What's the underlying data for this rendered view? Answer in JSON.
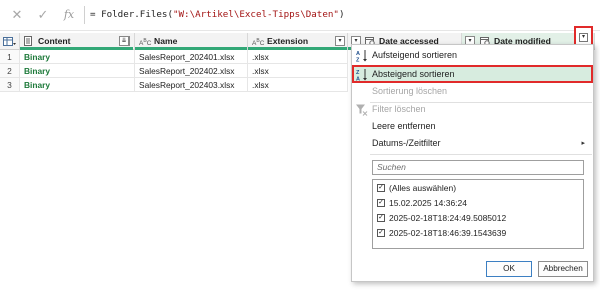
{
  "formula_bar": {
    "cancel_icon": "close-icon",
    "confirm_icon": "check-icon",
    "fx_label": "fx",
    "formula_prefix": "= Folder.Files(",
    "formula_string": "\"W:\\Artikel\\Excel-Tipps\\Daten\"",
    "formula_suffix": ")"
  },
  "columns": [
    {
      "type_icon": "table-icon",
      "label": ""
    },
    {
      "type_icon": "binary-type-icon",
      "label": "Content"
    },
    {
      "type_icon": "text-type-icon",
      "label": "Name"
    },
    {
      "type_icon": "text-type-icon",
      "label": "Extension"
    },
    {
      "type_icon": "datetime-type-icon",
      "label": "Date accessed"
    },
    {
      "type_icon": "datetime-type-icon",
      "label": "Date modified"
    }
  ],
  "rows": [
    {
      "num": "1",
      "content": "Binary",
      "name": "SalesReport_202401.xlsx",
      "extension": ".xlsx"
    },
    {
      "num": "2",
      "content": "Binary",
      "name": "SalesReport_202402.xlsx",
      "extension": ".xlsx"
    },
    {
      "num": "3",
      "content": "Binary",
      "name": "SalesReport_202403.xlsx",
      "extension": ".xlsx"
    }
  ],
  "menu": {
    "sort_asc": "Aufsteigend sortieren",
    "sort_desc": "Absteigend sortieren",
    "clear_sort": "Sortierung löschen",
    "clear_filter": "Filter löschen",
    "remove_empty": "Leere entfernen",
    "date_filter": "Datums-/Zeitfilter",
    "search_placeholder": "Suchen",
    "select_all": "(Alles auswählen)",
    "values": [
      "15.02.2025 14:36:24",
      "2025-02-18T18:24:49.5085012",
      "2025-02-18T18:46:39.1543639"
    ],
    "ok": "OK",
    "cancel": "Abbrechen"
  },
  "colors": {
    "accent_green": "#33a877",
    "highlight_red": "#e12a2a",
    "binary_text": "#1d7a3a"
  }
}
